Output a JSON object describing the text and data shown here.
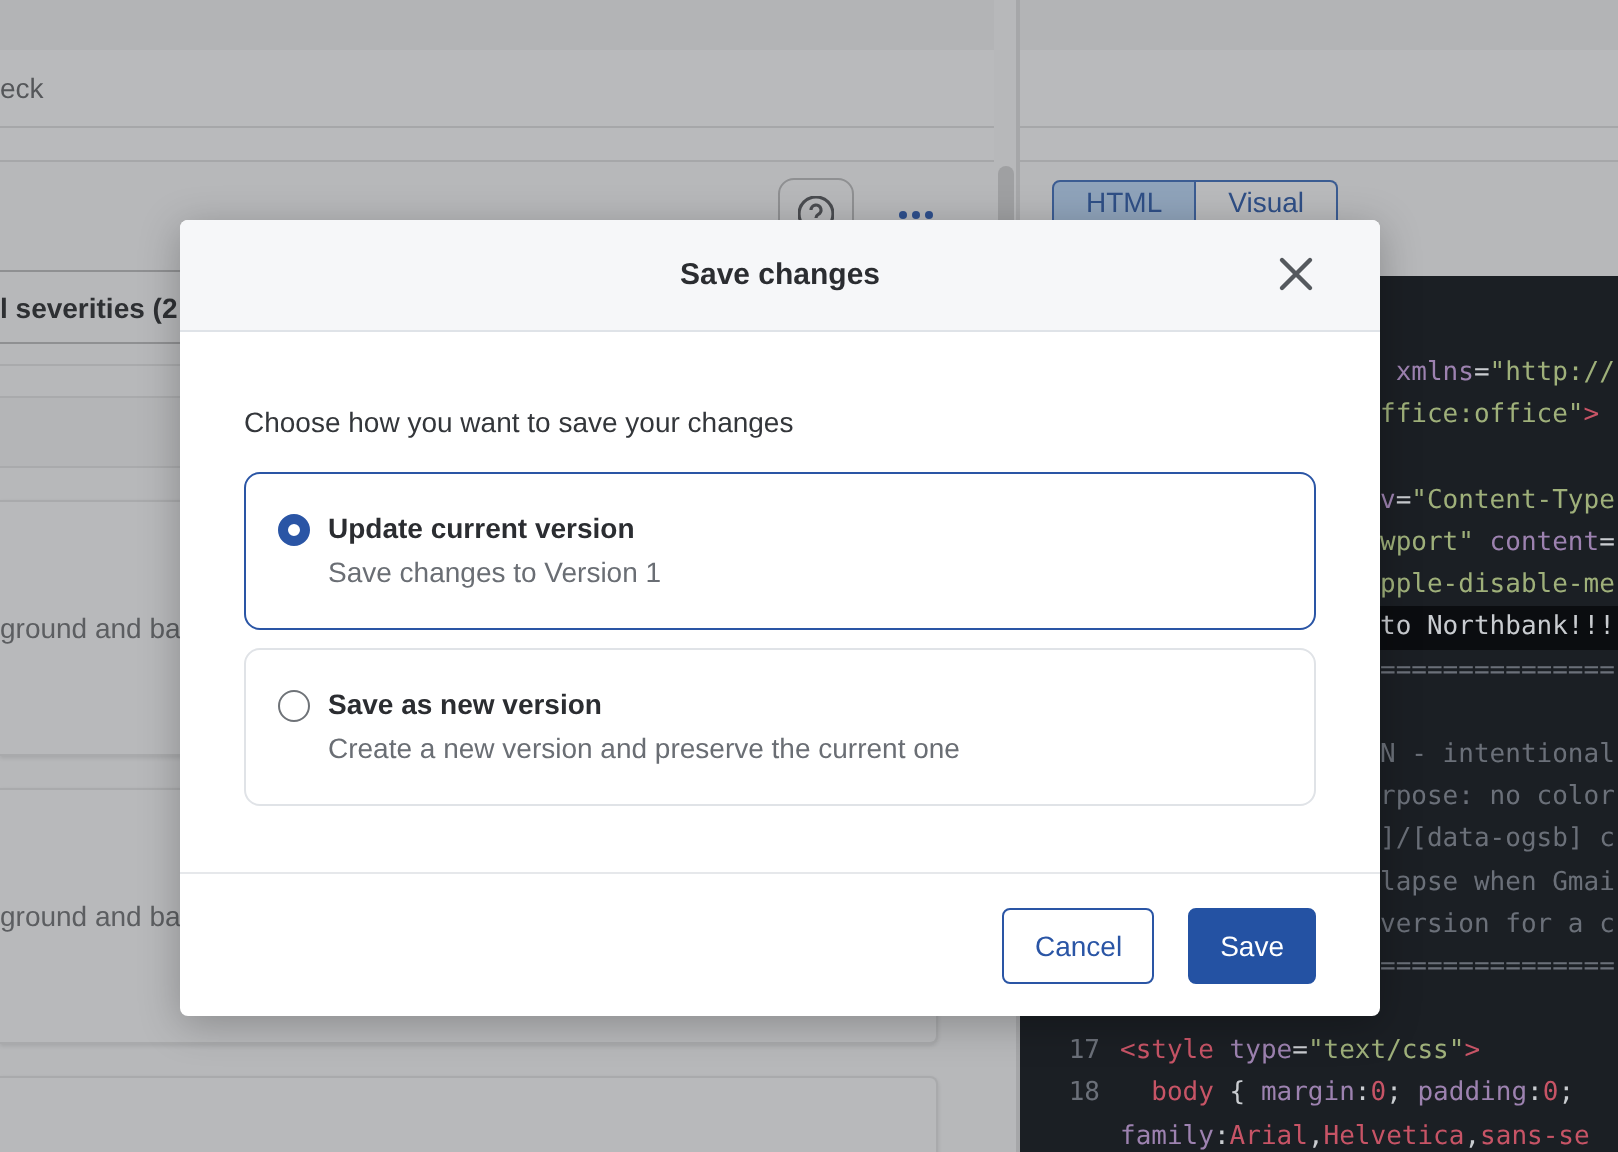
{
  "background": {
    "breadcrumb": "eck",
    "severity_tab": "l severities (2",
    "card_texts": [
      "ground and ba",
      "ground and ba"
    ]
  },
  "editor": {
    "tabs": [
      {
        "label": "HTML",
        "selected": true
      },
      {
        "label": "Visual",
        "selected": false
      }
    ],
    "lines": [
      {
        "kind": "blank",
        "highlighted": false
      },
      {
        "kind": "partial",
        "highlighted": false,
        "segments": [
          {
            "kind": "attr",
            "text": " xmlns"
          },
          {
            "kind": "plain",
            "text": "="
          },
          {
            "kind": "string",
            "text": "\"http://"
          }
        ]
      },
      {
        "kind": "partial",
        "highlighted": false,
        "segments": [
          {
            "kind": "string",
            "text": "ffice:office\""
          },
          {
            "kind": "tag",
            "text": ">"
          }
        ]
      },
      {
        "kind": "blank",
        "highlighted": false
      },
      {
        "kind": "partial",
        "highlighted": false,
        "segments": [
          {
            "kind": "attr",
            "text": "v"
          },
          {
            "kind": "plain",
            "text": "="
          },
          {
            "kind": "string",
            "text": "\"Content-Type"
          }
        ]
      },
      {
        "kind": "partial",
        "highlighted": false,
        "segments": [
          {
            "kind": "string",
            "text": "wport\""
          },
          {
            "kind": "attr",
            "text": " content"
          },
          {
            "kind": "plain",
            "text": "="
          }
        ]
      },
      {
        "kind": "partial",
        "highlighted": false,
        "segments": [
          {
            "kind": "string",
            "text": "pple-disable-me"
          }
        ]
      },
      {
        "kind": "partial",
        "highlighted": true,
        "segments": [
          {
            "kind": "plain",
            "text": "to Northbank!!!"
          }
        ]
      },
      {
        "kind": "partial",
        "highlighted": false,
        "segments": [
          {
            "kind": "comment",
            "text": "==============="
          }
        ]
      },
      {
        "kind": "blank",
        "highlighted": false
      },
      {
        "kind": "partial",
        "highlighted": false,
        "segments": [
          {
            "kind": "comment",
            "text": "N - intentional"
          }
        ]
      },
      {
        "kind": "partial",
        "highlighted": false,
        "segments": [
          {
            "kind": "comment",
            "text": "rpose: no color"
          }
        ]
      },
      {
        "kind": "partial",
        "highlighted": false,
        "segments": [
          {
            "kind": "comment",
            "text": "]/[data-ogsb] c"
          }
        ]
      },
      {
        "kind": "partial",
        "highlighted": false,
        "segments": [
          {
            "kind": "comment",
            "text": "lapse when Gmai"
          }
        ]
      },
      {
        "kind": "partial",
        "highlighted": false,
        "segments": [
          {
            "kind": "comment",
            "text": "version for a c"
          }
        ]
      },
      {
        "kind": "partial",
        "highlighted": false,
        "segments": [
          {
            "kind": "comment",
            "text": "==============="
          }
        ]
      },
      {
        "kind": "blank",
        "highlighted": false
      },
      {
        "kind": "numbered",
        "highlighted": false,
        "number": "17",
        "segments": [
          {
            "kind": "tag",
            "text": "<style"
          },
          {
            "kind": "attr",
            "text": " type"
          },
          {
            "kind": "plain",
            "text": "="
          },
          {
            "kind": "string",
            "text": "\"text/css\""
          },
          {
            "kind": "tag",
            "text": ">"
          }
        ]
      },
      {
        "kind": "numbered",
        "highlighted": false,
        "number": "18",
        "segments": [
          {
            "kind": "tag",
            "text": "  body"
          },
          {
            "kind": "plain",
            "text": " { "
          },
          {
            "kind": "attr",
            "text": "margin"
          },
          {
            "kind": "plain",
            "text": ":"
          },
          {
            "kind": "tag",
            "text": "0"
          },
          {
            "kind": "plain",
            "text": "; "
          },
          {
            "kind": "attr",
            "text": "padding"
          },
          {
            "kind": "plain",
            "text": ":"
          },
          {
            "kind": "tag",
            "text": "0"
          },
          {
            "kind": "plain",
            "text": ";"
          }
        ]
      },
      {
        "kind": "continued",
        "highlighted": false,
        "segments": [
          {
            "kind": "attr",
            "text": "family"
          },
          {
            "kind": "plain",
            "text": ":"
          },
          {
            "kind": "tag",
            "text": "Arial"
          },
          {
            "kind": "plain",
            "text": ","
          },
          {
            "kind": "tag",
            "text": "Helvetica"
          },
          {
            "kind": "plain",
            "text": ","
          },
          {
            "kind": "tag",
            "text": "sans-se"
          }
        ]
      }
    ]
  },
  "dialog": {
    "title": "Save changes",
    "prompt": "Choose how you want to save your changes",
    "options": [
      {
        "label": "Update current version",
        "description": "Save changes to Version 1",
        "selected": true
      },
      {
        "label": "Save as new version",
        "description": "Create a new version and preserve the current one",
        "selected": false
      }
    ],
    "buttons": [
      {
        "label": "Cancel",
        "kind": "secondary"
      },
      {
        "label": "Save",
        "kind": "primary"
      }
    ]
  }
}
